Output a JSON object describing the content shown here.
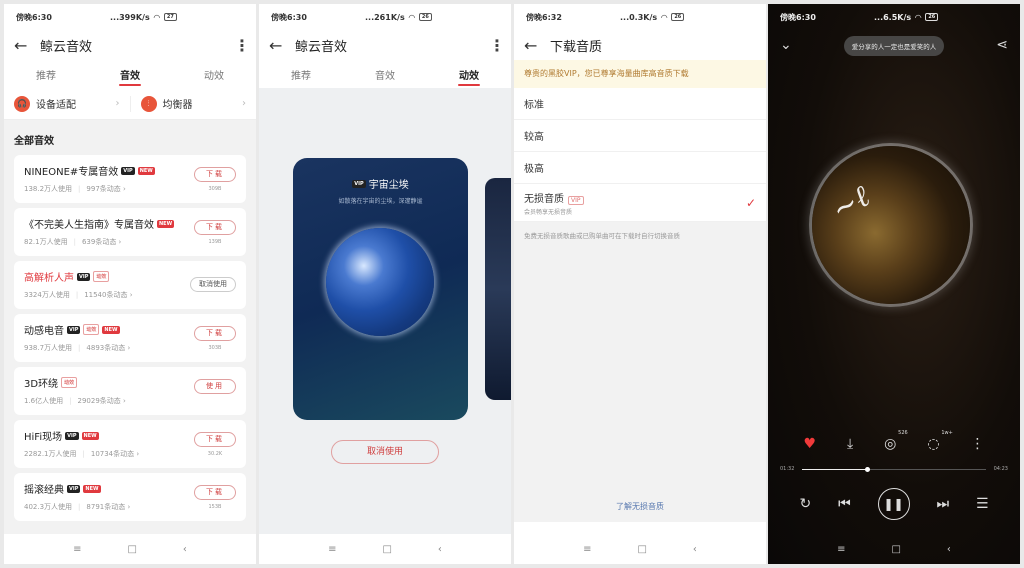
{
  "screens": {
    "effects": {
      "status": {
        "time": "傍晚6:30",
        "net": "...399K/s",
        "battery": "27"
      },
      "title": "鲸云音效",
      "tabs": [
        "推荐",
        "音效",
        "动效"
      ],
      "active_tab": "音效",
      "quick": [
        {
          "label": "设备适配",
          "icon": "headphones-icon"
        },
        {
          "label": "均衡器",
          "icon": "equalizer-icon"
        }
      ],
      "section_title": "全部音效",
      "items": [
        {
          "name": "NINEONE#专属音效",
          "badges": [
            "VIP",
            "NEW"
          ],
          "users": "138.2万人使用",
          "posts": "997条动态",
          "button": "下载",
          "size": "309B"
        },
        {
          "name": "《不完美人生指南》专属音效",
          "badges": [
            "NEW"
          ],
          "users": "82.1万人使用",
          "posts": "639条动态",
          "button": "下载",
          "size": "139B"
        },
        {
          "name": "高解析人声",
          "badges": [
            "VIP",
            "动效"
          ],
          "users": "3324万人使用",
          "posts": "11540条动态",
          "button": "取消使用",
          "size": "",
          "active": true
        },
        {
          "name": "动感电音",
          "badges": [
            "VIP",
            "动效",
            "NEW"
          ],
          "users": "938.7万人使用",
          "posts": "4893条动态",
          "button": "下载",
          "size": "303B"
        },
        {
          "name": "3D环绕",
          "badges": [
            "动效"
          ],
          "users": "1.6亿人使用",
          "posts": "29029条动态",
          "button": "使用",
          "size": ""
        },
        {
          "name": "HiFi现场",
          "badges": [
            "VIP",
            "NEW"
          ],
          "users": "2282.1万人使用",
          "posts": "10734条动态",
          "button": "下载",
          "size": "30.2K"
        },
        {
          "name": "摇滚经典",
          "badges": [
            "VIP",
            "NEW"
          ],
          "users": "402.3万人使用",
          "posts": "8791条动态",
          "button": "下载",
          "size": "153B"
        }
      ]
    },
    "animations": {
      "status": {
        "time": "傍晚6:30",
        "net": "...261K/s",
        "battery": "26"
      },
      "title": "鲸云音效",
      "tabs": [
        "推荐",
        "音效",
        "动效"
      ],
      "active_tab": "动效",
      "card_title": "宇宙尘埃",
      "card_badge": "VIP",
      "card_subtitle": "如散落在宇宙的尘埃，深邃静谧",
      "cancel_label": "取消使用"
    },
    "quality": {
      "status": {
        "time": "傍晚6:32",
        "net": "...0.3K/s",
        "battery": "26"
      },
      "title": "下载音质",
      "vip_notice": "尊贵的黑胶VIP，您已尊享海量曲库高音质下载",
      "options": [
        {
          "label": "标准"
        },
        {
          "label": "较高"
        },
        {
          "label": "极高"
        },
        {
          "label": "无损音质",
          "tag": "VIP",
          "sub": "会员畅享无损音质",
          "selected": true
        }
      ],
      "note": "免费无损音质歌曲或已购单曲可在下载时自行切换音质",
      "learn_more": "了解无损音质"
    },
    "player": {
      "status": {
        "time": "傍晚6:30",
        "net": "...6.5K/s",
        "battery": "26"
      },
      "tip": "爱分享的人一定也是爱笑的人",
      "comment_count": "526",
      "review_count": "1w+",
      "current_time": "01:32",
      "total_time": "04:23",
      "progress": 0.35,
      "liked": true
    }
  },
  "nav": {
    "menu": "≡",
    "home": "□",
    "back": "‹"
  }
}
